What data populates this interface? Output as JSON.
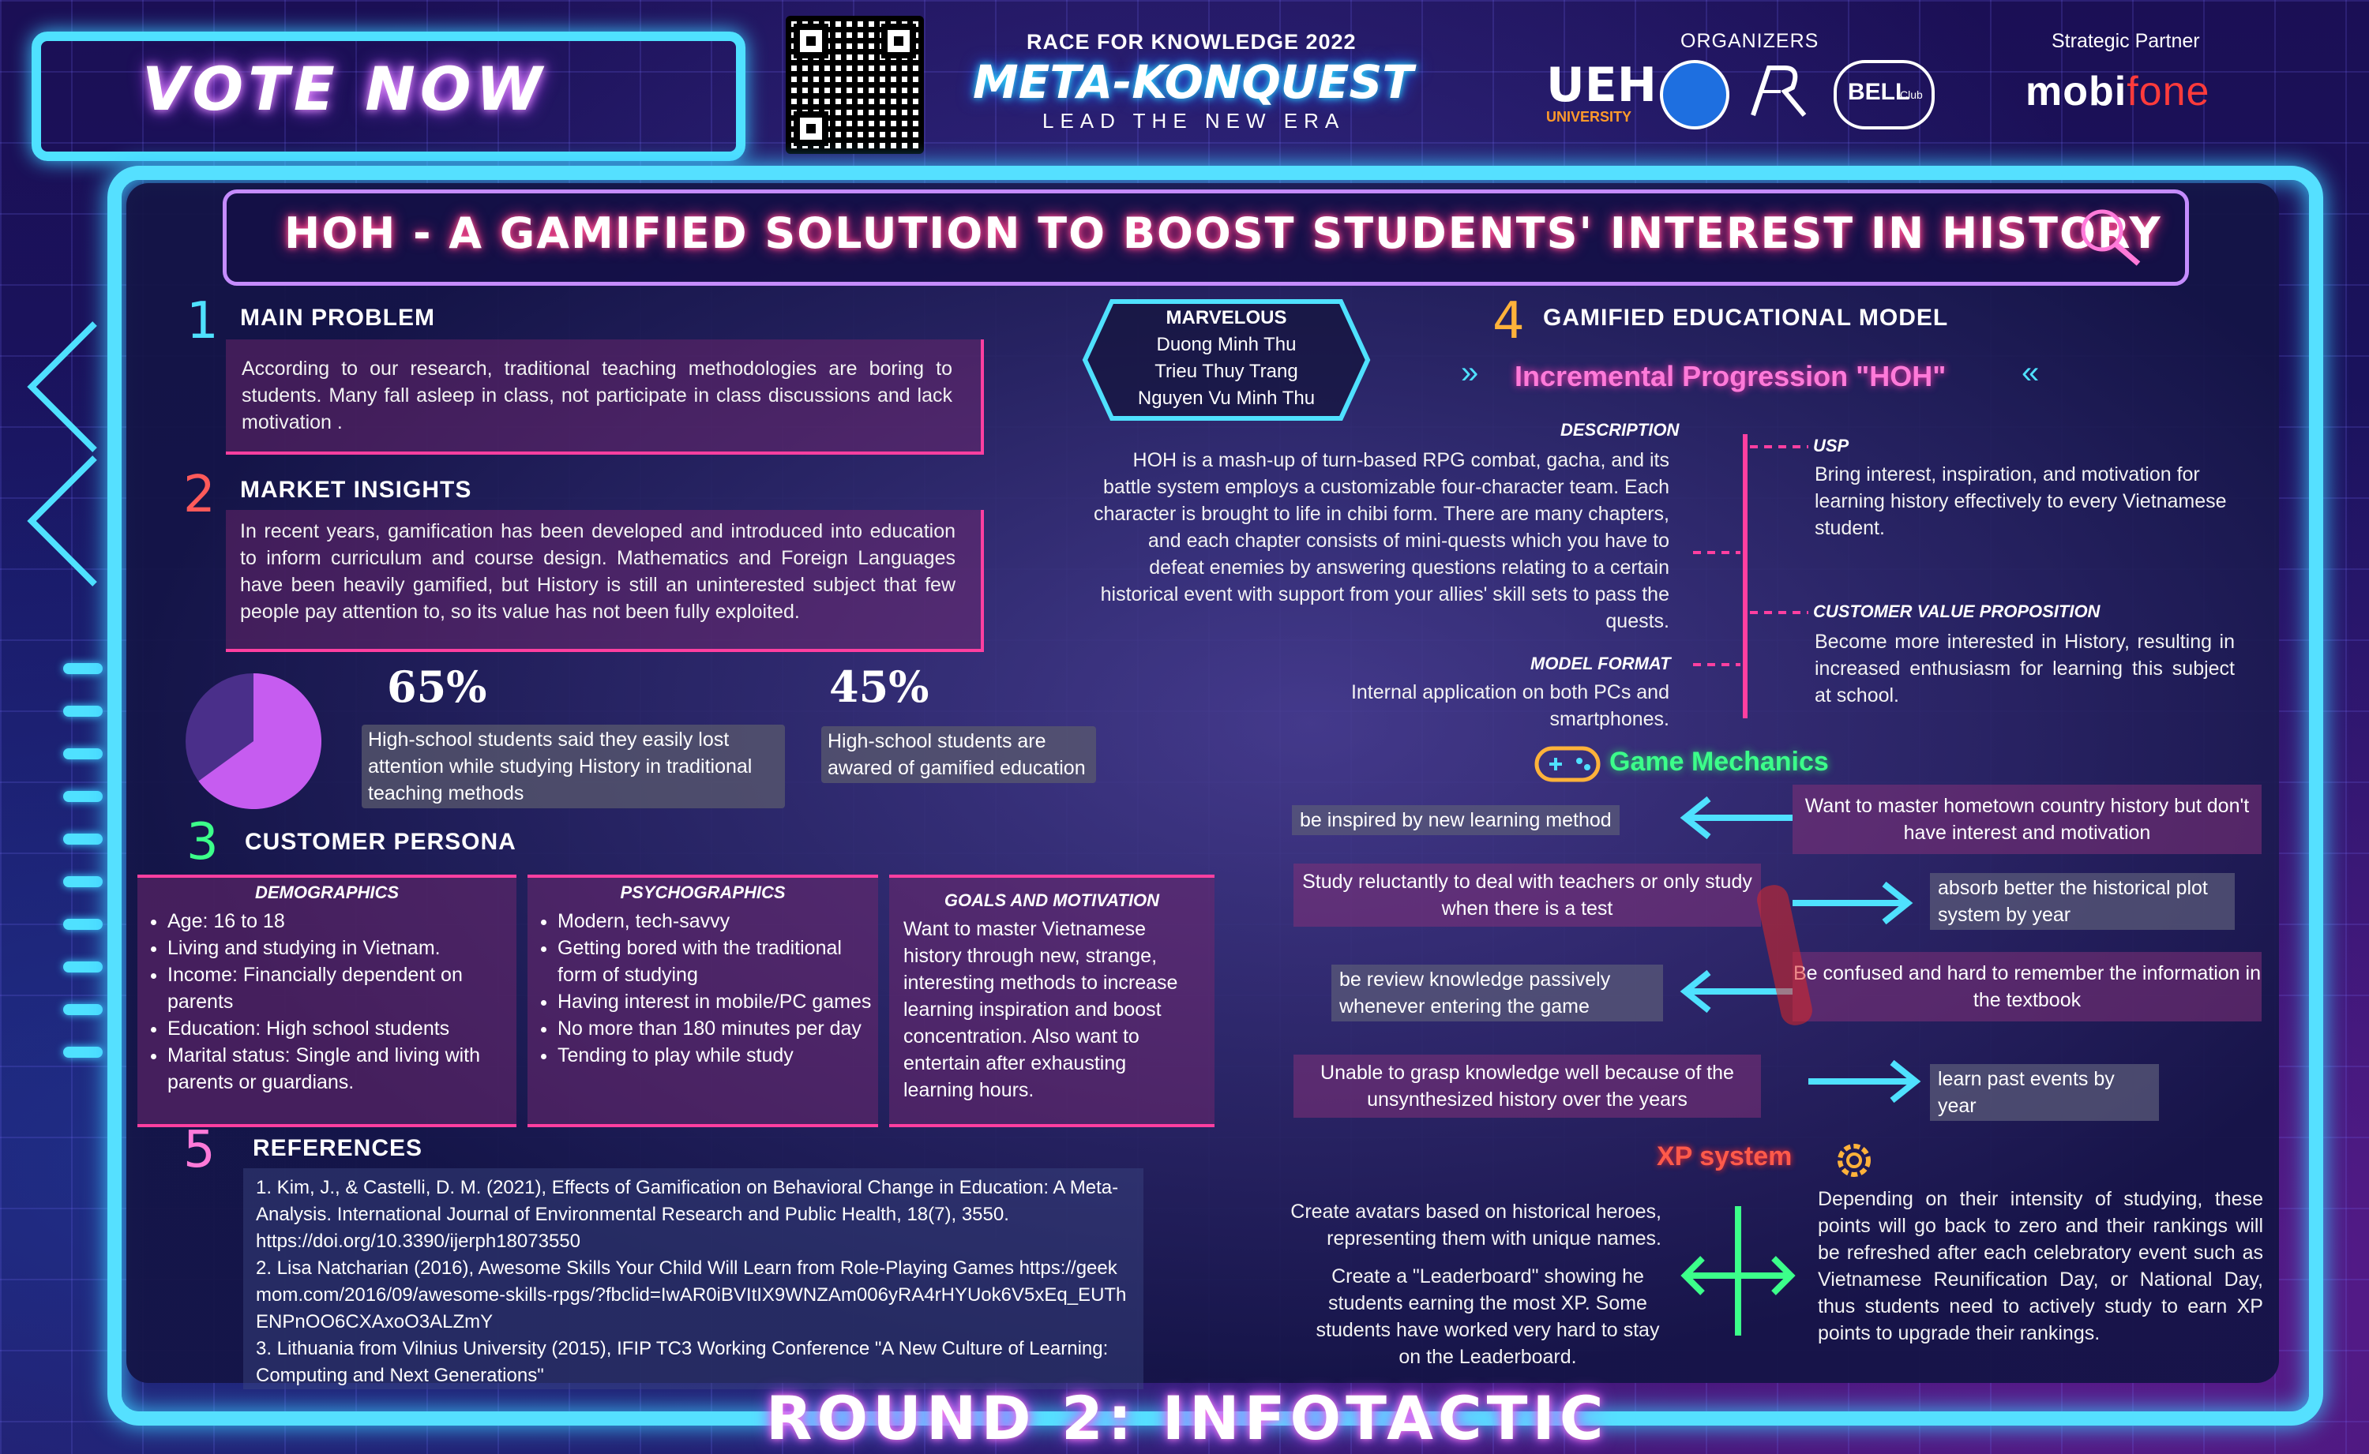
{
  "header": {
    "vote": "VOTE NOW",
    "race": "RACE FOR KNOWLEDGE 2022",
    "meta": "META-KONQUEST",
    "lead": "LEAD THE NEW ERA",
    "organizers": "ORGANIZERS",
    "ueh": "UEH",
    "ueh_sub": "UNIVERSITY",
    "bell": "BELL",
    "bell_sub": "Club",
    "partner_title": "Strategic Partner",
    "partner_a": "mobi",
    "partner_b": "fone"
  },
  "title": "HOH - A GAMIFIED SOLUTION TO BOOST STUDENTS' INTEREST IN HISTORY",
  "team": {
    "name": "MARVELOUS",
    "members": [
      "Duong Minh Thu",
      "Trieu Thuy Trang",
      "Nguyen Vu Minh Thu"
    ]
  },
  "s1": {
    "num": "1",
    "head": "MAIN PROBLEM",
    "text": "According to our research, traditional teaching methodologies are boring to students. Many fall asleep in class, not participate in class discussions and lack motivation ."
  },
  "s2": {
    "num": "2",
    "head": "MARKET INSIGHTS",
    "text": "In recent years, gamification has been developed and introduced into education to inform curriculum and course design. Mathematics and Foreign Languages have been heavily gamified, but History is still an uninterested subject that few people pay attention to, so its value has not been fully exploited.",
    "stat1_value": "65%",
    "stat1_text": "High-school students said they easily lost attention while studying History in traditional teaching methods",
    "stat1_fraction": 0.65,
    "stat2_value": "45%",
    "stat2_text": "High-school students are awared of gamified education"
  },
  "s3": {
    "num": "3",
    "head": "CUSTOMER PERSONA",
    "demo_head": "DEMOGRAPHICS",
    "demo": [
      "Age: 16 to 18",
      "Living and studying in Vietnam.",
      "Income: Financially dependent on parents",
      "Education: High school students",
      "Marital status: Single and living with parents or guardians."
    ],
    "psycho_head": "PSYCHOGRAPHICS",
    "psycho": [
      "Modern, tech-savvy",
      "Getting bored with the traditional form of studying",
      "Having interest in mobile/PC games",
      "No more than 180 minutes per day",
      "Tending to play while study"
    ],
    "goals_head": "GOALS AND MOTIVATION",
    "goals": "Want to master Vietnamese history through new, strange, interesting methods to increase learning inspiration and boost concentration. Also want to entertain after exhausting learning hours."
  },
  "s4": {
    "num": "4",
    "head": "GAMIFIED EDUCATIONAL MODEL",
    "subtitle": "Incremental Progression \"HOH\"",
    "desc_label": "DESCRIPTION",
    "desc": "HOH is a mash-up of turn-based RPG combat, gacha, and its battle system employs a customizable four-character team. Each character is brought to life in chibi form. There are many chapters, and each chapter consists of mini-quests which you have to defeat enemies by answering questions relating to a certain historical event with support from your allies' skill sets to pass the quests.",
    "model_label": "MODEL FORMAT",
    "model": "Internal application on both PCs and smartphones.",
    "usp_label": "USP",
    "usp": "Bring interest, inspiration, and motivation for learning history effectively to every Vietnamese student.",
    "cvp_label": "CUSTOMER VALUE PROPOSITION",
    "cvp": "Become more interested in History, resulting in increased enthusiasm for learning this subject at school."
  },
  "mechanics": {
    "head": "Game Mechanics",
    "left": [
      "be inspired by new learning method",
      "Study reluctantly to deal with teachers or only study when there is a test",
      "be review knowledge passively whenever entering the game",
      "Unable to grasp knowledge well because of the unsynthesized history over the years"
    ],
    "right": [
      "Want to master hometown country history but don't have interest and motivation",
      "absorb better the historical plot system by year",
      "Be confused and hard to remember the information in the textbook",
      "learn past events by year"
    ]
  },
  "xp": {
    "head": "XP system",
    "left1": "Create avatars based on historical heroes, representing them with unique names.",
    "left2": "Create a \"Leaderboard\" showing he students earning  the most XP. Some students have worked very hard  to stay on the Leaderboard.",
    "right": "Depending on their intensity of studying, these points will go back to zero and their rankings will be refreshed after each celebratory event such as Vietnamese Reunification Day, or National Day, thus students need to actively study to earn XP points to upgrade their rankings."
  },
  "s5": {
    "num": "5",
    "head": "REFERENCES",
    "refs": [
      "1. Kim, J., & Castelli, D. M. (2021), Effects of Gamification on Behavioral Change in Education: A Meta-Analysis. International Journal of Environmental Research and Public Health, 18(7), 3550. https://doi.org/10.3390/ijerph18073550",
      "2. Lisa Natcharian (2016), Awesome Skills Your Child Will Learn from Role-Playing Games https://geekmom.com/2016/09/awesome-skills-rpgs/?fbclid=IwAR0iBVItIX9WNZAm006yRA4rHYUok6V5xEq_EUThENPnOO6CXAxoO3ALZmY",
      "3. Lithuania from Vilnius University (2015), IFIP TC3 Working Conference \"A New Culture of Learning: Computing and Next Generations\""
    ]
  },
  "footer": "ROUND 2: INFOTACTIC",
  "colors": {
    "neon_cyan": "#55e0ff",
    "neon_pink": "#ff3fa0",
    "neon_green": "#3cff8a",
    "purple_slice": "#c65cf0"
  }
}
